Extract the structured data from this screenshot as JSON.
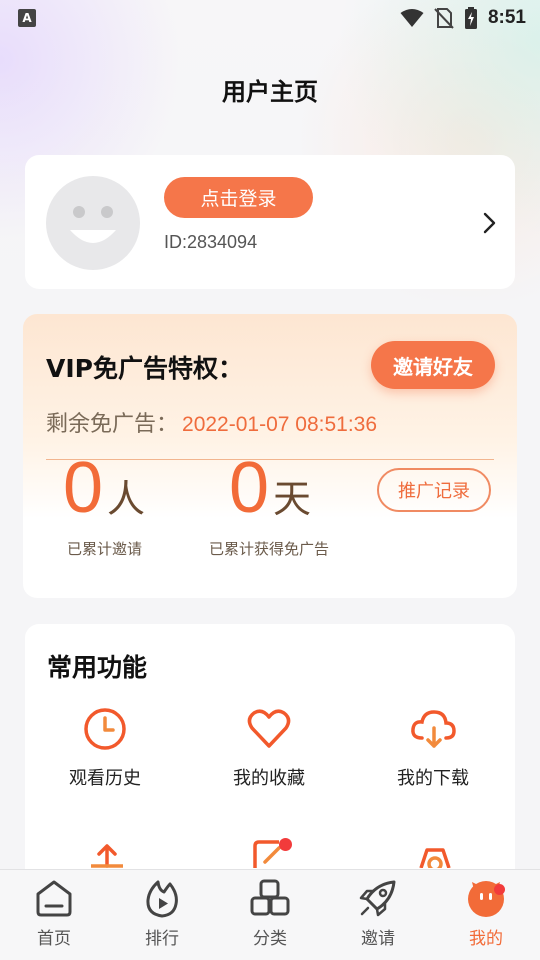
{
  "status_bar": {
    "left_icon": "A",
    "time": "8:51",
    "icons": [
      "wifi-icon",
      "no-sim-icon",
      "battery-charging-icon"
    ]
  },
  "header": {
    "title": "用户主页"
  },
  "user_card": {
    "login_label": "点击登录",
    "user_id": "ID:2834094",
    "avatar_icon": "smiley-avatar-icon",
    "arrow_icon": "chevron-right-icon"
  },
  "vip": {
    "title": "VIP免广告特权：",
    "invite_label": "邀请好友",
    "remaining_label": "剩余免广告：",
    "remaining_value": "2022-01-07 08:51:36",
    "invited_count": "0",
    "invited_unit": "人",
    "invited_label": "已累计邀请",
    "days_count": "0",
    "days_unit": "天",
    "days_label": "已累计获得免广告",
    "records_label": "推广记录"
  },
  "functions": {
    "title": "常用功能",
    "items": [
      {
        "label": "观看历史",
        "icon": "clock-icon"
      },
      {
        "label": "我的收藏",
        "icon": "heart-icon"
      },
      {
        "label": "我的下载",
        "icon": "cloud-download-icon"
      }
    ],
    "partial_icons": [
      "upload-icon",
      "edit-icon",
      "settings-icon"
    ]
  },
  "tab_bar": {
    "items": [
      {
        "label": "首页",
        "icon": "home-icon"
      },
      {
        "label": "排行",
        "icon": "flame-play-icon"
      },
      {
        "label": "分类",
        "icon": "category-icon"
      },
      {
        "label": "邀请",
        "icon": "rocket-icon"
      },
      {
        "label": "我的",
        "icon": "profile-face-icon"
      }
    ],
    "active_index": 4
  },
  "colors": {
    "accent": "#f5764a",
    "accent_text": "#ef6c3d",
    "badge": "#f23b3b"
  }
}
